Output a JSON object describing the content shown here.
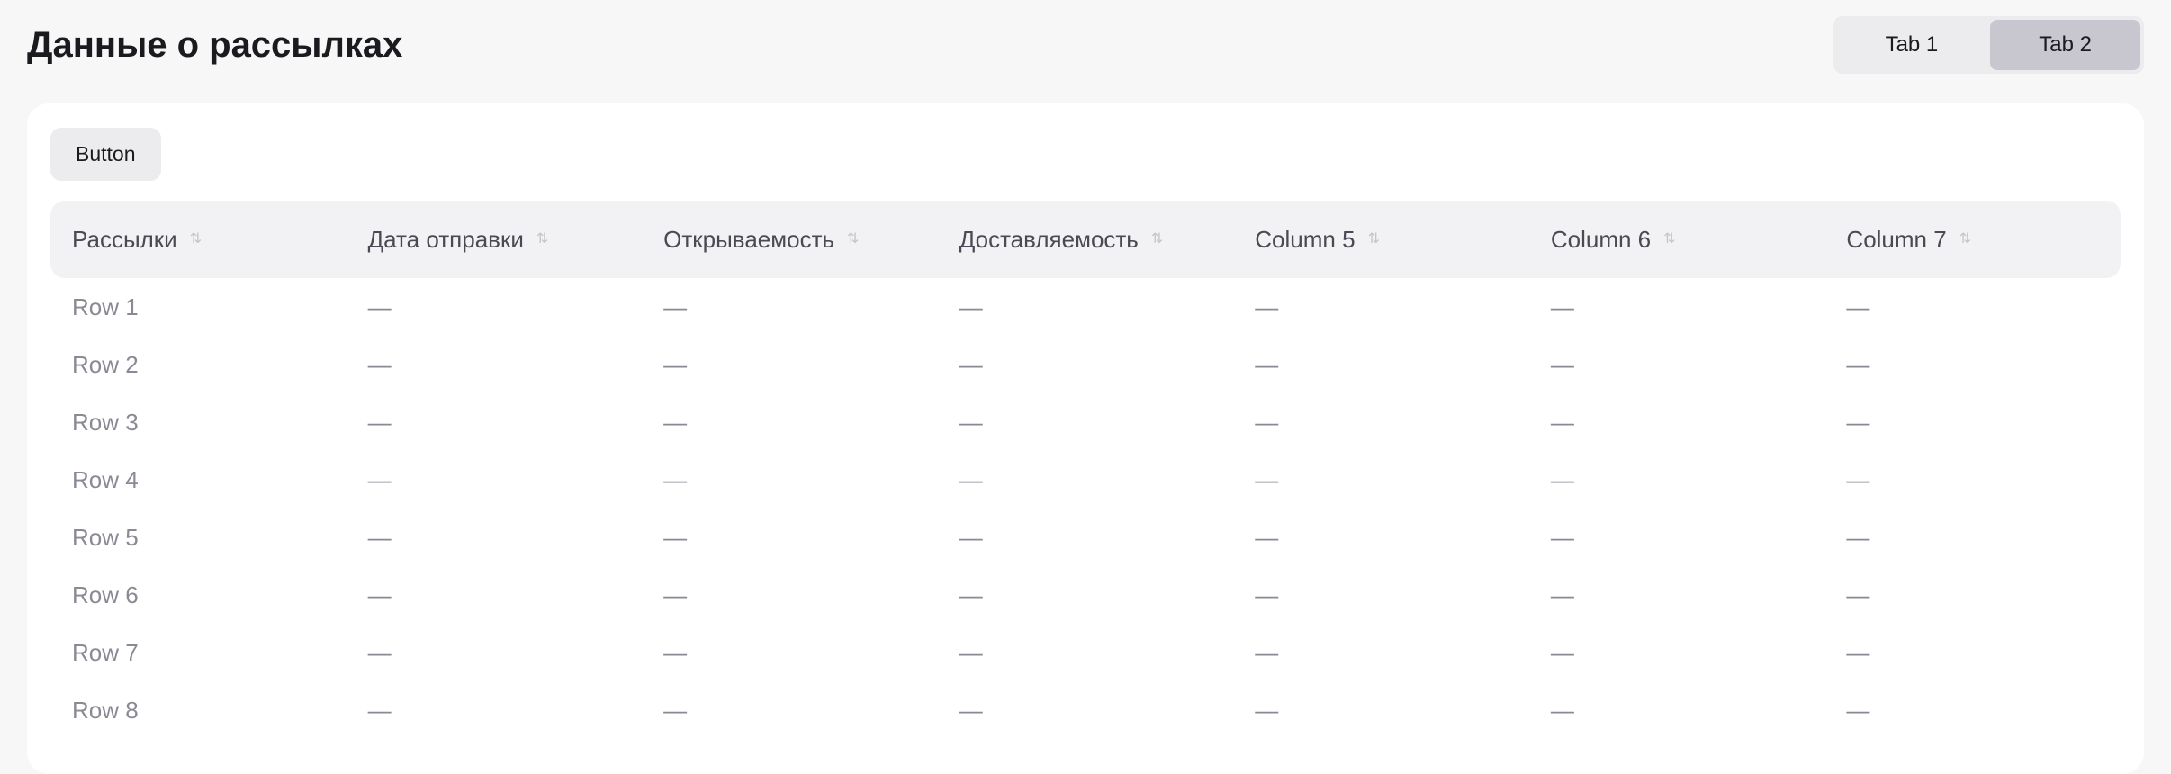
{
  "page": {
    "title": "Данные о рассылках"
  },
  "view_switch": {
    "tabs": [
      "Tab 1",
      "Tab 2"
    ]
  },
  "toolbar": {
    "compare_label": "Button"
  },
  "table": {
    "columns": [
      "Рассылки",
      "Дата отправки",
      "Открываемость",
      "Доставляемость",
      "Column 5",
      "Column 6",
      "Column 7"
    ],
    "rows": [
      [
        "Row 1",
        "—",
        "—",
        "—",
        "—",
        "—",
        "—"
      ],
      [
        "Row 2",
        "—",
        "—",
        "—",
        "—",
        "—",
        "—"
      ],
      [
        "Row 3",
        "—",
        "—",
        "—",
        "—",
        "—",
        "—"
      ],
      [
        "Row 4",
        "—",
        "—",
        "—",
        "—",
        "—",
        "—"
      ],
      [
        "Row 5",
        "—",
        "—",
        "—",
        "—",
        "—",
        "—"
      ],
      [
        "Row 6",
        "—",
        "—",
        "—",
        "—",
        "—",
        "—"
      ],
      [
        "Row 7",
        "—",
        "—",
        "—",
        "—",
        "—",
        "—"
      ],
      [
        "Row 8",
        "—",
        "—",
        "—",
        "—",
        "—",
        "—"
      ]
    ]
  }
}
